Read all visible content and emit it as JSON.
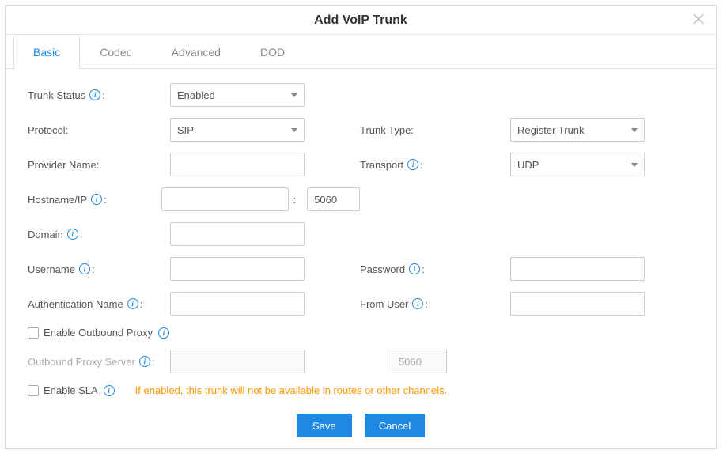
{
  "dialog": {
    "title": "Add VoIP Trunk"
  },
  "tabs": {
    "basic": "Basic",
    "codec": "Codec",
    "advanced": "Advanced",
    "dod": "DOD"
  },
  "labels": {
    "trunk_status": "Trunk Status",
    "protocol": "Protocol:",
    "provider_name": "Provider Name:",
    "hostname_ip": "Hostname/IP",
    "domain": "Domain",
    "username": "Username",
    "auth_name": "Authentication Name",
    "enable_outbound_proxy": "Enable Outbound Proxy",
    "outbound_proxy_server": "Outbound Proxy Server",
    "enable_sla": "Enable SLA",
    "trunk_type": "Trunk Type:",
    "transport": "Transport",
    "password": "Password",
    "from_user": "From User",
    "colon": ":"
  },
  "values": {
    "trunk_status": "Enabled",
    "protocol": "SIP",
    "provider_name": "",
    "hostname_ip": "",
    "hostname_port": "5060",
    "domain": "",
    "username": "",
    "auth_name": "",
    "outbound_proxy_server": "",
    "outbound_proxy_port": "5060",
    "trunk_type": "Register Trunk",
    "transport": "UDP",
    "password": "",
    "from_user": ""
  },
  "notes": {
    "sla": "If enabled, this trunk will not be available in routes or other channels."
  },
  "buttons": {
    "save": "Save",
    "cancel": "Cancel"
  }
}
